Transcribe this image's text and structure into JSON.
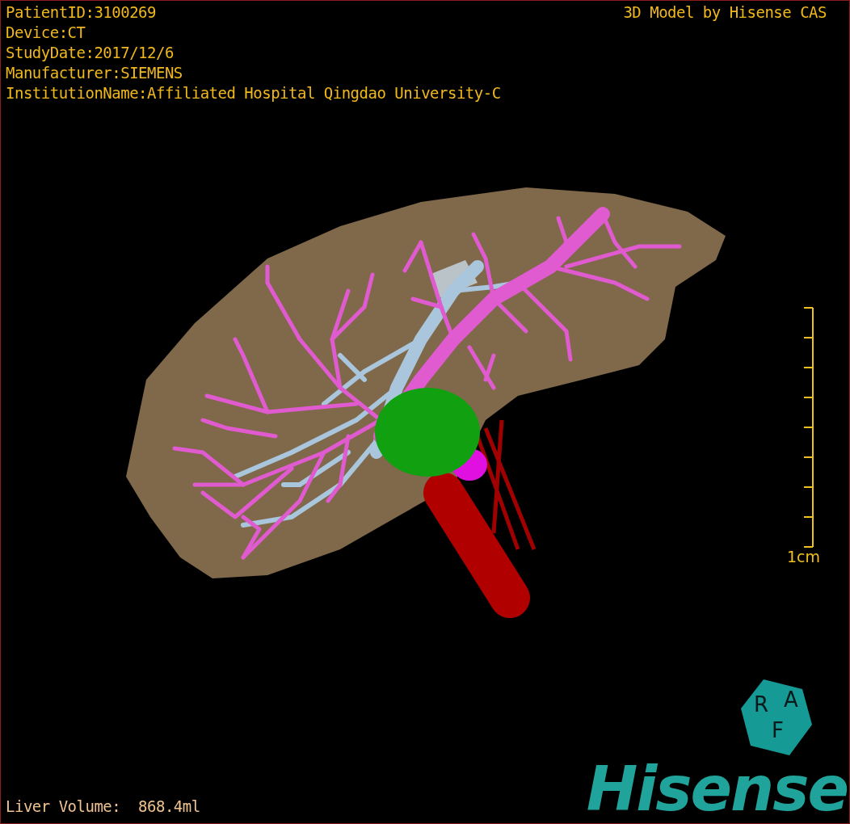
{
  "study_info": [
    "PatientID:3100269",
    "Device:CT",
    "StudyDate:2017/12/6",
    "Manufacturer:SIEMENS",
    "InstitutionName:Affiliated Hospital Qingdao University-C"
  ],
  "viewer_title": "3D Model by Hisense CAS",
  "scale_bar": {
    "label": "1cm"
  },
  "liver_volume": "Liver Volume:  868.4ml",
  "orientation_cube": {
    "labels": [
      "R",
      "A",
      "F"
    ]
  },
  "logo": "Hisense"
}
